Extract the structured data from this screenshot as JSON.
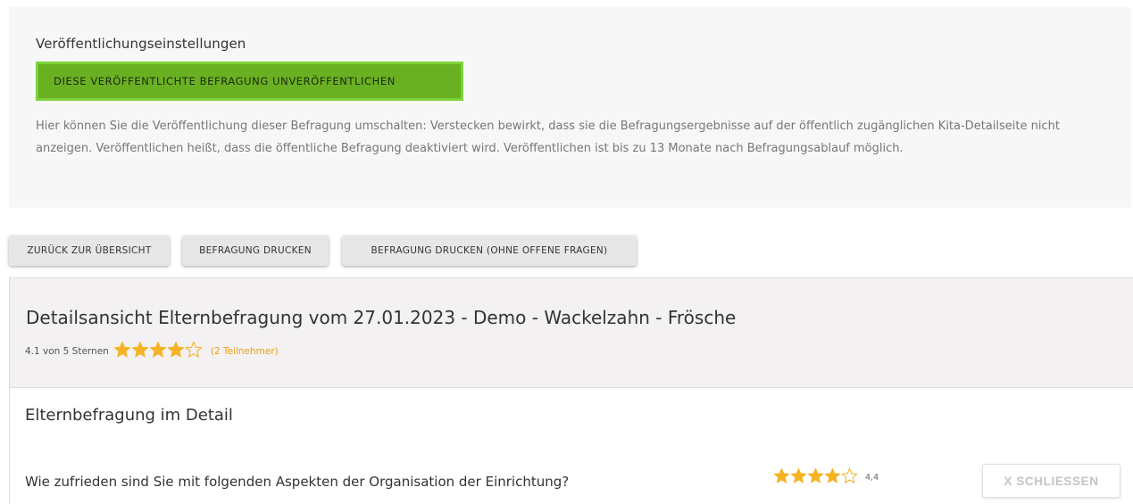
{
  "settings": {
    "heading": "Veröffentlichungseinstellungen",
    "unpublish_button": "DIESE VERÖFFENTLICHTE BEFRAGUNG UNVERÖFFENTLICHEN",
    "help_text": "Hier können Sie die Veröffentlichung dieser Befragung umschalten: Verstecken bewirkt, dass sie die Befragungsergebnisse auf der öffentlich zugänglichen Kita-Detailseite nicht anzeigen. Veröffentlichen heißt, dass die öffentliche Befragung deaktiviert wird. Veröffentlichen ist bis zu 13 Monate nach Befragungsablauf möglich."
  },
  "actions": {
    "back": "ZURÜCK ZUR ÜBERSICHT",
    "print": "BEFRAGUNG DRUCKEN",
    "print_no_open": "BEFRAGUNG DRUCKEN (OHNE OFFENE FRAGEN)"
  },
  "detail": {
    "title": "Detailsansicht Elternbefragung vom 27.01.2023 - Demo - Wackelzahn - Frösche",
    "rating_text": "4.1 von 5 Sternen",
    "rating_value": 4.1,
    "rating_max": 5,
    "participants": "(2 Teilnehmer)"
  },
  "section": {
    "title": "Elternbefragung im Detail",
    "question": "Wie zufrieden sind Sie mit folgenden Aspekten der Organisation der Einrichtung?",
    "question_score": "4,4",
    "question_rating_value": 4.4,
    "close_button": "X SCHLIESSEN"
  },
  "icons": {
    "star_filled": "star-filled-icon",
    "star_empty": "star-empty-icon"
  },
  "colors": {
    "star": "#f4b323",
    "accent_green": "#6ab023",
    "participants": "#e9a117"
  }
}
